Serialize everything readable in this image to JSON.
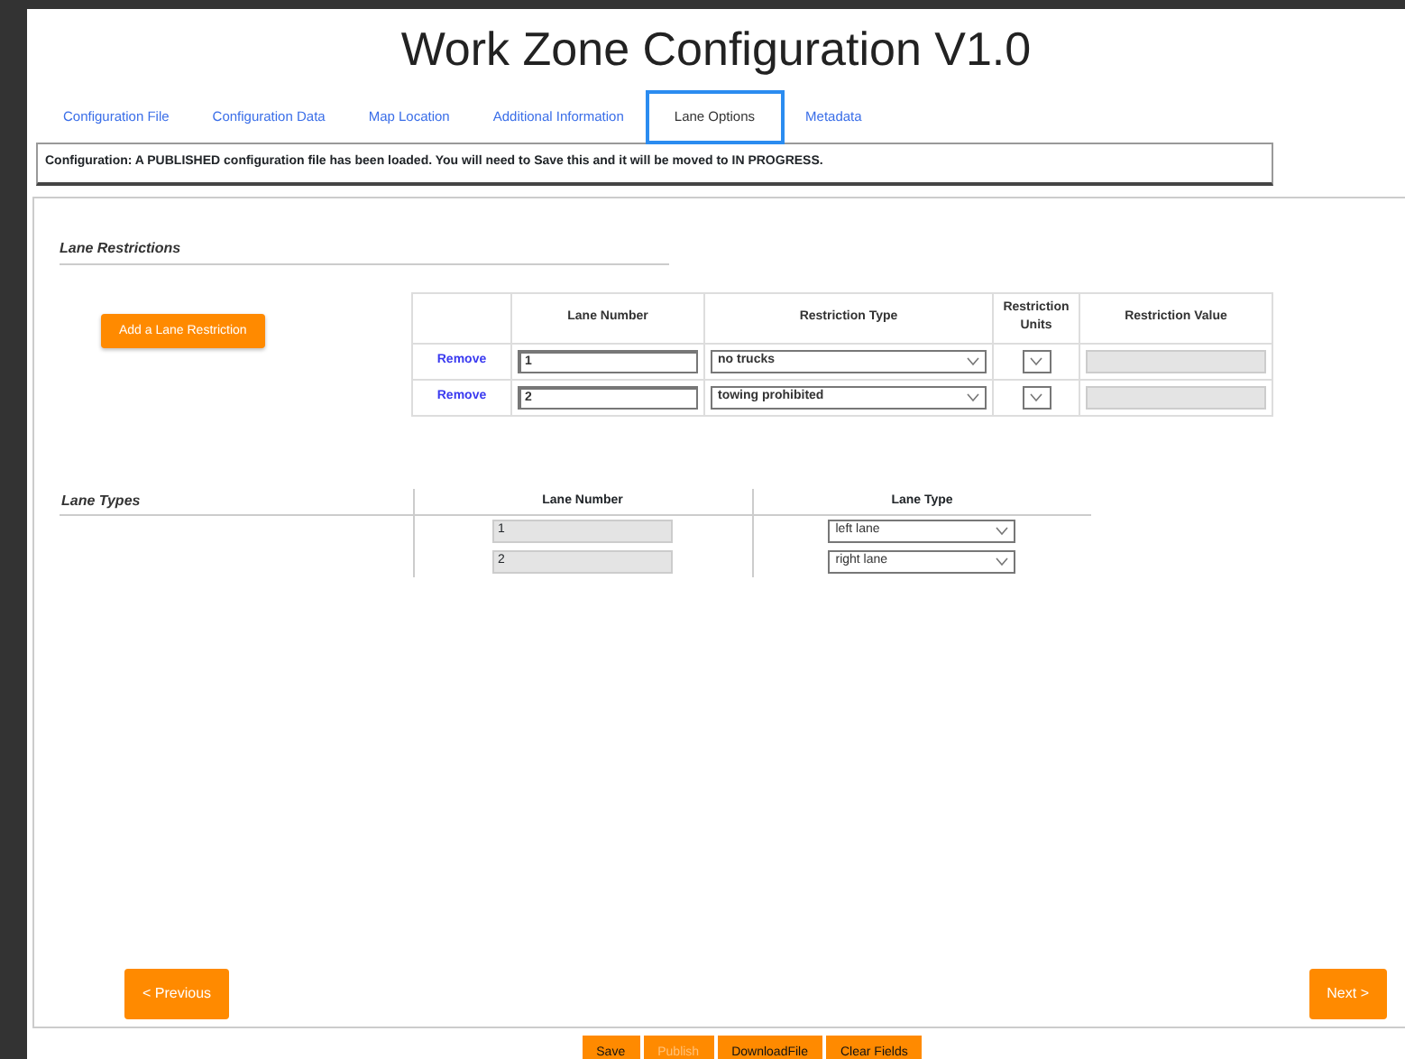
{
  "title": "Work Zone Configuration V1.0",
  "tabs": [
    {
      "label": "Configuration File",
      "selected": false
    },
    {
      "label": "Configuration Data",
      "selected": false
    },
    {
      "label": "Map Location",
      "selected": false
    },
    {
      "label": "Additional Information",
      "selected": false
    },
    {
      "label": "Lane Options",
      "selected": true
    },
    {
      "label": "Metadata",
      "selected": false
    }
  ],
  "status": "Configuration: A PUBLISHED configuration file has been loaded. You will need to Save this and it will be moved to IN PROGRESS.",
  "lane_restrictions": {
    "heading": "Lane Restrictions",
    "add_button": "Add a Lane Restriction",
    "columns": [
      "Lane Number",
      "Restriction Type",
      "Restriction Units",
      "Restriction Value"
    ],
    "rows": [
      {
        "action": "Remove",
        "lane_number": "1",
        "restriction_type": "no trucks",
        "value_disabled": true
      },
      {
        "action": "Remove",
        "lane_number": "2",
        "restriction_type": "towing prohibited",
        "value_disabled": true
      }
    ]
  },
  "lane_types": {
    "heading": "Lane Types",
    "columns": [
      "Lane Number",
      "Lane Type"
    ],
    "rows": [
      {
        "lane_number": "1",
        "lane_number_disabled": true,
        "lane_type": "left lane"
      },
      {
        "lane_number": "2",
        "lane_number_disabled": true,
        "lane_type": "right lane"
      }
    ]
  },
  "nav": {
    "previous": "< Previous",
    "next": "Next >"
  },
  "actions": [
    {
      "label": "Save",
      "disabled": false
    },
    {
      "label": "Publish",
      "disabled": true
    },
    {
      "label": "DownloadFile",
      "disabled": false
    },
    {
      "label": "Clear Fields",
      "disabled": false
    }
  ]
}
